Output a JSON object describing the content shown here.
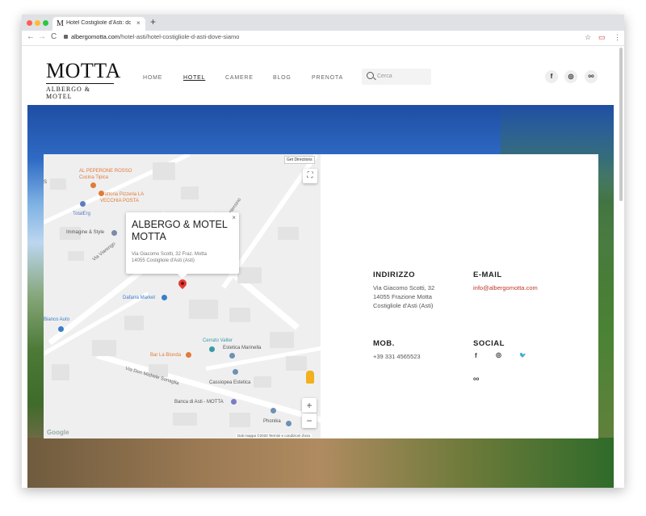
{
  "browser": {
    "tab_title": "Hotel Costigliole d'Asti: dove s",
    "tab_favicon": "M",
    "tab_close": "×",
    "new_tab": "+",
    "url_domain": "albergomotta.com",
    "url_path": "/hotel-asti/hotel-costigliole-d-asti-dove-siamo",
    "back": "←",
    "forward": "→",
    "reload": "C",
    "star_icon": "☆",
    "menu_icon": "⋮",
    "traffic_lights": [
      "#ff5f57",
      "#febc2e",
      "#28c840"
    ]
  },
  "header": {
    "logo_main": "MOTTA",
    "logo_sub": "ALBERGO & MOTEL",
    "nav": [
      "HOME",
      "HOTEL",
      "CAMERE",
      "BLOG",
      "PRENOTA"
    ],
    "active_nav": "HOTEL",
    "search_placeholder": "Cerca",
    "social": {
      "facebook": "f",
      "instagram": "◎",
      "tripadvisor": "oo"
    }
  },
  "map": {
    "get_directions": "Get Directions",
    "popup_title": "ALBERGO & MOTEL MOTTA",
    "popup_address_line1": "Via Giacomo Scotti, 32 Fraz. Motta",
    "popup_address_line2": "14055 Costigliole d'Asti (Asti)",
    "popup_close": "×",
    "zoom_in": "+",
    "zoom_out": "−",
    "fullscreen": "⛶",
    "google": "Google",
    "credits": "Dati mappa ©2020   Termini e condizioni d'uso",
    "streets": [
      "Via Viarengo",
      "Via Don Michele Sonaglia",
      "Via Duca Montersino"
    ],
    "places": [
      {
        "name": "AL PEPERONE ROSSO",
        "color": "#e07b39"
      },
      {
        "name": "Cucina Tipica",
        "color": "#e07b39"
      },
      {
        "name": "Trattoria Pizzeria LA",
        "color": "#e07b39"
      },
      {
        "name": "VECCHIA POSTA",
        "color": "#e07b39"
      },
      {
        "name": "TotalErg",
        "color": "#5c7cc4"
      },
      {
        "name": "Immagine & Style",
        "color": "#555555"
      },
      {
        "name": "Dafarra Market",
        "color": "#3a7dc9"
      },
      {
        "name": "Bianco Auto",
        "color": "#3a7dc9"
      },
      {
        "name": "Cerrato Valter",
        "color": "#3a9aa8"
      },
      {
        "name": "Estetica Marinella",
        "color": "#555555"
      },
      {
        "name": "Bar La Bionda",
        "color": "#e07b39"
      },
      {
        "name": "Cassiopea Estetica",
        "color": "#555555"
      },
      {
        "name": "Banca di Asti - MOTTA",
        "color": "#555555"
      },
      {
        "name": "Phonika",
        "color": "#555555"
      },
      {
        "name": "S",
        "color": "#555555"
      }
    ]
  },
  "contact": {
    "address_heading": "INDIRIZZO",
    "address_lines": [
      "Via Giacomo Scotti, 32",
      "14055 Frazione Motta",
      "Costigliole d'Asti (Asti)"
    ],
    "email_heading": "E-MAIL",
    "email": "info@albergomotta.com",
    "phone_heading": "MOB.",
    "phone": "+39 331 4565523",
    "social_heading": "SOCIAL",
    "social_icons": {
      "facebook": "f",
      "instagram": "◎",
      "twitter": "🐦",
      "tripadvisor": "oo"
    }
  },
  "colors": {
    "accent": "#c0392b",
    "map_bg": "#efefef"
  }
}
